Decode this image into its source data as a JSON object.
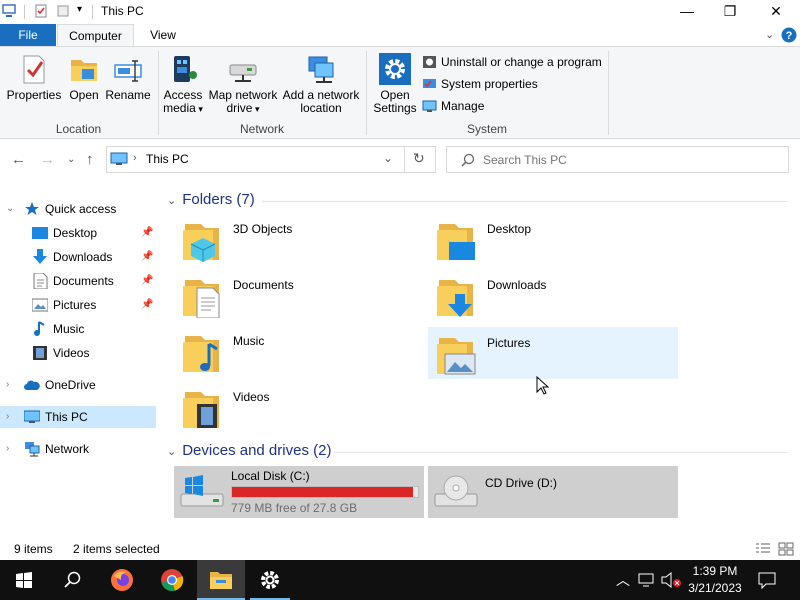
{
  "window": {
    "title": "This PC",
    "controls": {
      "minimize": "—",
      "maximize": "❐",
      "close": "✕"
    }
  },
  "ribbon": {
    "tabs": {
      "file": "File",
      "computer": "Computer",
      "view": "View"
    },
    "location": {
      "properties": "Properties",
      "open": "Open",
      "rename": "Rename",
      "group_label": "Location"
    },
    "network": {
      "access_media_l1": "Access",
      "access_media_l2": "media",
      "map_drive_l1": "Map network",
      "map_drive_l2": "drive",
      "add_location_l1": "Add a network",
      "add_location_l2": "location",
      "group_label": "Network"
    },
    "system": {
      "open_settings_l1": "Open",
      "open_settings_l2": "Settings",
      "uninstall": "Uninstall or change a program",
      "system_properties": "System properties",
      "manage": "Manage",
      "group_label": "System"
    }
  },
  "address": {
    "path": "This PC",
    "search_placeholder": "Search This PC"
  },
  "nav": {
    "quick_access": "Quick access",
    "quick_items": [
      {
        "label": "Desktop"
      },
      {
        "label": "Downloads"
      },
      {
        "label": "Documents"
      },
      {
        "label": "Pictures"
      },
      {
        "label": "Music"
      },
      {
        "label": "Videos"
      }
    ],
    "onedrive": "OneDrive",
    "this_pc": "This PC",
    "network": "Network"
  },
  "folders": {
    "header": "Folders (7)",
    "items": [
      {
        "name": "3D Objects"
      },
      {
        "name": "Desktop"
      },
      {
        "name": "Documents"
      },
      {
        "name": "Downloads"
      },
      {
        "name": "Music"
      },
      {
        "name": "Pictures"
      },
      {
        "name": "Videos"
      }
    ]
  },
  "drives": {
    "header": "Devices and drives (2)",
    "items": [
      {
        "name": "Local Disk (C:)",
        "free": "779 MB free of 27.8 GB",
        "used_fraction": 0.973
      },
      {
        "name": "CD Drive (D:)"
      }
    ]
  },
  "status": {
    "items": "9 items",
    "selected": "2 items selected"
  },
  "taskbar": {
    "time": "1:39 PM",
    "date": "3/21/2023"
  },
  "colors": {
    "accent": "#1a6ec0",
    "selection": "#cce8ff",
    "disk_full": "#da2626",
    "folder": "#f8cf5a"
  }
}
